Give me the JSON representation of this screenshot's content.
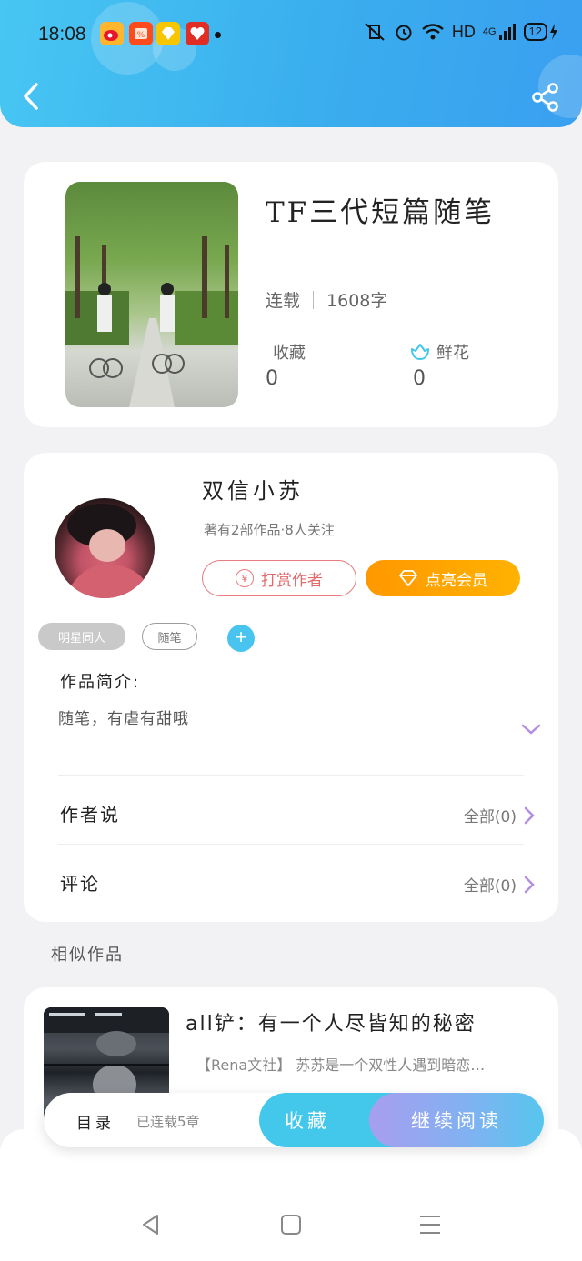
{
  "status_bar": {
    "time": "18:08",
    "notification_icons": [
      "weibo-icon",
      "coupon-icon",
      "diamond-icon",
      "pinduoduo-icon"
    ],
    "network": "HD",
    "signal": "4G",
    "battery": "12"
  },
  "header": {
    "back_icon": "chevron-left-icon",
    "share_icon": "share-icon"
  },
  "book": {
    "title": "TF三代短篇随笔",
    "status": "连载",
    "word_count": "1608字",
    "favorites_label": "收藏",
    "favorites_count": "0",
    "flowers_label": "鲜花",
    "flowers_count": "0"
  },
  "author": {
    "name": "双信小苏",
    "meta": "著有2部作品·8人关注",
    "reward_label": "打赏作者",
    "vip_label": "点亮会员",
    "tags": [
      "明星同人",
      "随笔"
    ],
    "add_tag": "+",
    "intro_title": "作品简介:",
    "intro_text": "随笔，有虐有甜哦",
    "author_says_label": "作者说",
    "author_says_count": "全部(0)",
    "comments_label": "评论",
    "comments_count": "全部(0)"
  },
  "similar": {
    "title": "相似作品",
    "items": [
      {
        "title": "all铲：有一个人尽皆知的秘密",
        "description": "【Rena文社】 苏苏是一个双性人遇到暗恋…"
      }
    ]
  },
  "bottom_bar": {
    "toc_label": "目录",
    "toc_status": "已连载5章",
    "favorite_label": "收藏",
    "continue_label": "继续阅读"
  },
  "colors": {
    "header_blue": "#3aaeee",
    "accent_cyan": "#43c8ec",
    "vip_orange": "#ff9800",
    "reward_red": "#e4696b",
    "chevron_purple": "#b28ee0"
  }
}
